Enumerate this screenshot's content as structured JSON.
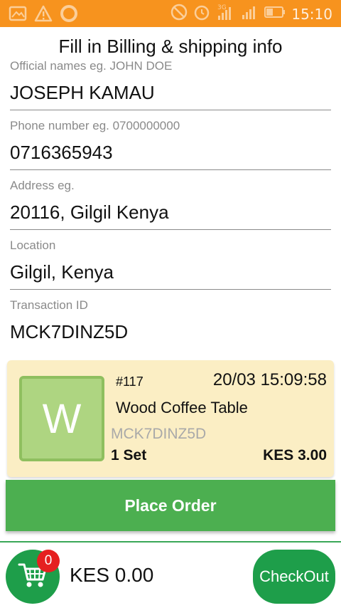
{
  "status_bar": {
    "time": "15:10",
    "network": "3G",
    "icons": [
      "image-icon",
      "warning-icon",
      "circle-app-icon",
      "mute-icon",
      "alarm-icon",
      "signal-icon",
      "signal-icon",
      "battery-icon"
    ]
  },
  "page": {
    "title": "Fill in Billing & shipping info"
  },
  "form": {
    "name_label": "Official names eg. JOHN DOE",
    "name_value": "JOSEPH KAMAU",
    "phone_label": "Phone number eg. 0700000000",
    "phone_value": "0716365943",
    "address_label": "Address eg.",
    "address_value": "20116, Gilgil Kenya",
    "location_label": "Location",
    "location_value": "Gilgil, Kenya",
    "tid_label": "Transaction ID",
    "tid_value": "MCK7DINZ5D"
  },
  "order": {
    "avatar_letter": "W",
    "number": "#117",
    "date": "20/03 15:09:58",
    "product": "Wood Coffee Table",
    "transaction_id": "MCK7DINZ5D",
    "quantity": "1 Set",
    "price": "KES 3.00"
  },
  "actions": {
    "place_order": "Place Order",
    "checkout": "CheckOut"
  },
  "cart": {
    "badge_count": "0",
    "total": "KES 0.00"
  },
  "colors": {
    "status_bar": "#f7931e",
    "primary_green": "#4caf50",
    "dark_green": "#1e9e4a",
    "card_bg": "#fbeec4",
    "avatar_bg": "#aed581",
    "badge_red": "#e52020"
  }
}
